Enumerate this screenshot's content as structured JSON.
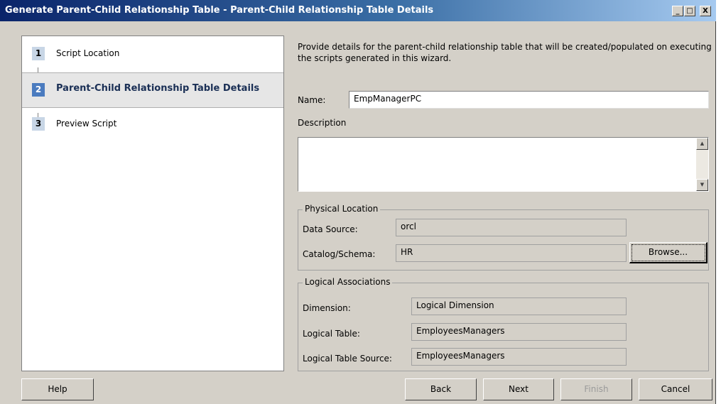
{
  "window": {
    "title": "Generate Parent-Child Relationship Table - Parent-Child Relationship Table Details",
    "controls": [
      "_",
      "□",
      "X"
    ]
  },
  "steps": [
    {
      "number": "1",
      "label": "Script Location"
    },
    {
      "number": "2",
      "label": "Parent-Child Relationship Table Details"
    },
    {
      "number": "3",
      "label": "Preview Script"
    }
  ],
  "main": {
    "description": "Provide details for the parent-child relationship table that will be created/populated on executing the scripts generated in this wizard.",
    "name_label": "Name:",
    "name_value": "EmpManagerPC",
    "description_label": "Description",
    "description_value": ""
  },
  "physical_location": {
    "legend": "Physical Location",
    "data_source_label": "Data Source:",
    "data_source_value": "orcl",
    "catalog_label": "Catalog/Schema:",
    "catalog_value": "HR",
    "browse_label": "Browse..."
  },
  "logical_associations": {
    "legend": "Logical Associations",
    "dimension_label": "Dimension:",
    "dimension_value": "Logical Dimension",
    "logical_table_label": "Logical Table:",
    "logical_table_value": "EmployeesManagers",
    "lts_label": "Logical Table Source:",
    "lts_value": "EmployeesManagers"
  },
  "buttons": {
    "help": "Help",
    "back": "Back",
    "next": "Next",
    "finish": "Finish",
    "cancel": "Cancel"
  },
  "colors": {
    "titlebar_start": "#0a246a",
    "titlebar_end": "#a6caf0",
    "dialog_bg": "#d4d0c8",
    "active_step_badge": "#4a7bbf"
  }
}
